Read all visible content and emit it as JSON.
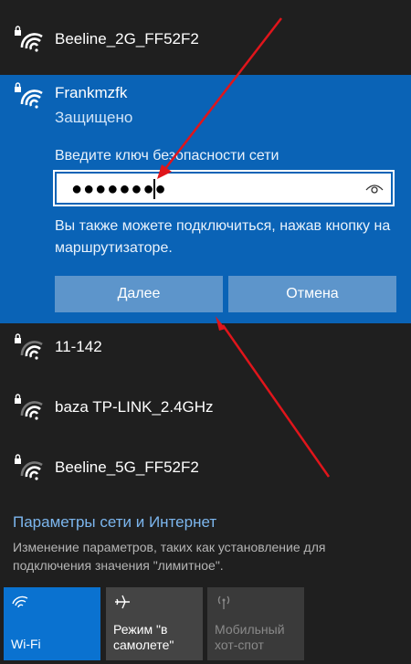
{
  "networks_top": [
    {
      "name": "Beeline_2G_FF52F2",
      "icon": "wifi-secured-icon"
    }
  ],
  "selected_network": {
    "name": "Frankmzfk",
    "status": "Защищено",
    "prompt": "Введите ключ безопасности сети",
    "password_value": "●●●●●●●●",
    "hint": "Вы также можете подключиться, нажав кнопку на маршрутизаторе.",
    "next_label": "Далее",
    "cancel_label": "Отмена",
    "icon": "wifi-secured-icon"
  },
  "networks_bottom": [
    {
      "name": "11-142",
      "icon": "wifi-secured-icon"
    },
    {
      "name": "baza TP-LINK_2.4GHz",
      "icon": "wifi-secured-icon"
    },
    {
      "name": "Beeline_5G_FF52F2",
      "icon": "wifi-secured-icon"
    }
  ],
  "settings": {
    "link": "Параметры сети и Интернет",
    "description": "Изменение параметров, таких как установление для подключения значения \"лимитное\"."
  },
  "quick_actions": [
    {
      "label": "Wi-Fi",
      "icon": "wifi-icon",
      "state": "on"
    },
    {
      "label": "Режим \"в самолете\"",
      "icon": "airplane-icon",
      "state": "off"
    },
    {
      "label": "Мобильный хот-спот",
      "icon": "hotspot-icon",
      "state": "disabled"
    }
  ],
  "colors": {
    "background": "#1f1f1f",
    "selected": "#0a63b6",
    "button": "#5d95cb",
    "link": "#7cb6ee",
    "wifi_tile": "#0a72d0",
    "annotation_arrow": "#e0151b"
  }
}
